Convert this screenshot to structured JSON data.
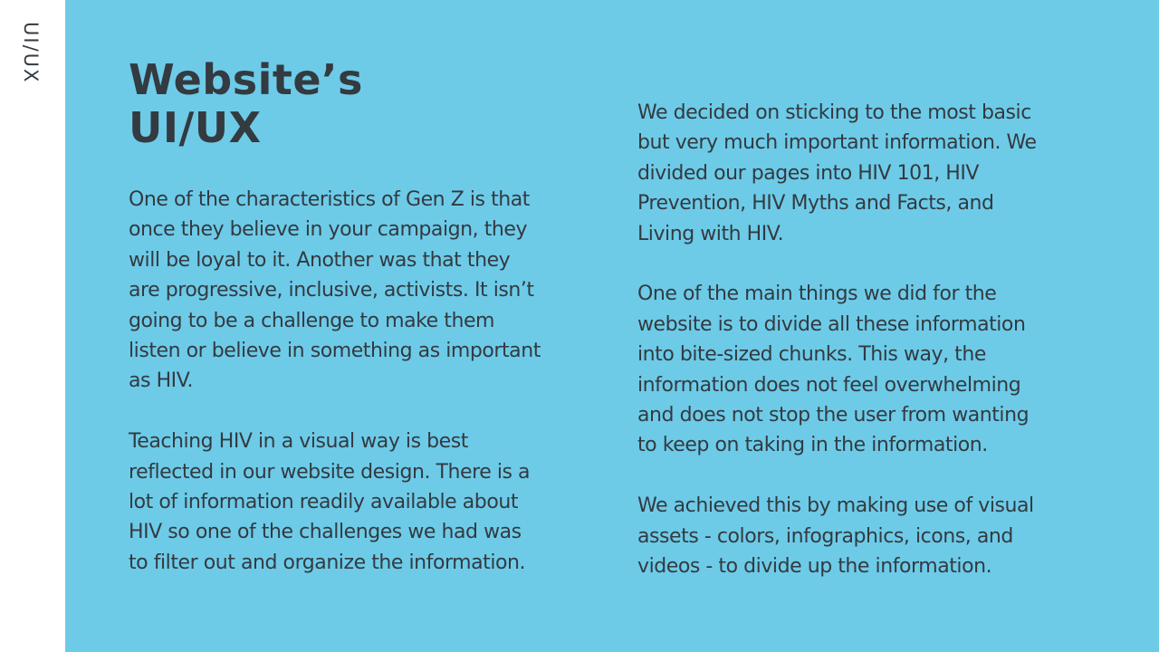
{
  "sidebar": {
    "label": "UI/UX"
  },
  "heading": {
    "line1": "Website’s",
    "line2": "UI/UX"
  },
  "left_column": {
    "paragraphs": [
      "One of the characteristics of Gen Z is that\nonce they believe in your campaign, they\nwill be loyal to it. Another was that they\nare progressive, inclusive, activists. It isn’t\ngoing to be a challenge to make them\nlisten or believe in something as important\nas HIV.",
      "Teaching HIV in a visual way is best\nreflected in our website design. There is a\nlot of information readily available about\nHIV so one of the challenges we had was\nto filter out and organize the information."
    ]
  },
  "right_column": {
    "paragraphs": [
      "We decided on sticking to the most basic\nbut very much important information. We\ndivided our pages into HIV 101, HIV\nPrevention, HIV Myths and Facts, and\nLiving with HIV.",
      "One of the main things we did for the\nwebsite is to divide all these information\ninto bite-sized chunks. This way, the\ninformation does not feel overwhelming\nand does not stop the user from wanting\nto keep on taking in the information.",
      "We achieved this by making use of visual\nassets - colors, infographics, icons, and\nvideos - to divide up the information."
    ]
  },
  "colors": {
    "panel_background": "#6dcbe8",
    "text": "#333a40",
    "sidebar_background": "#ffffff"
  }
}
